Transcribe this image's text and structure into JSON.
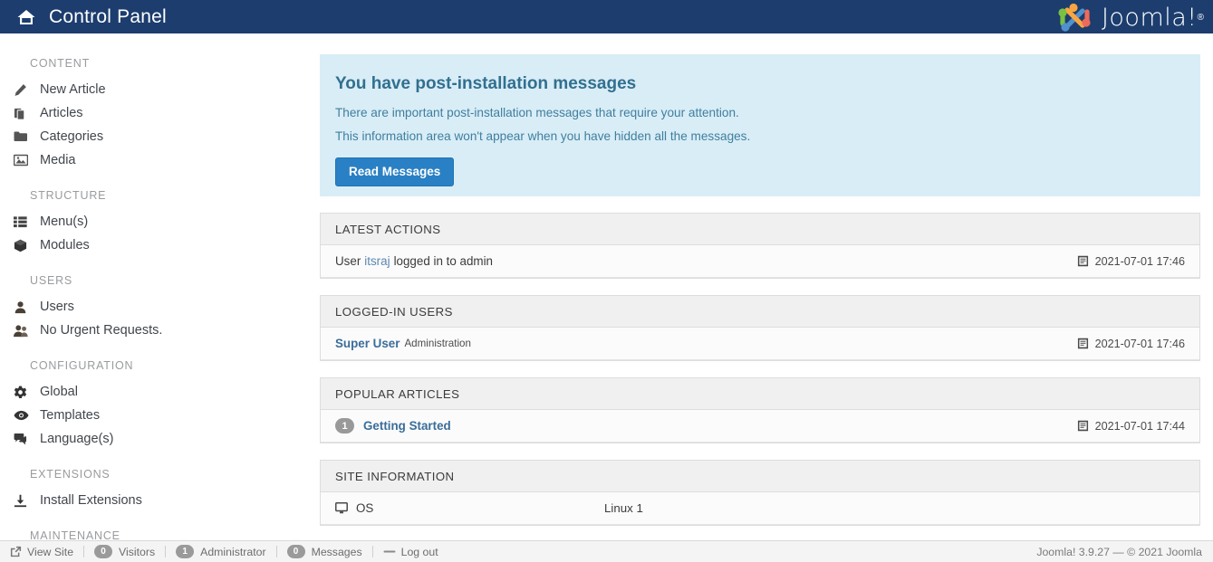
{
  "header": {
    "title": "Control Panel",
    "home_icon": "home-icon",
    "logo_text": "Joomla!",
    "logo_registered": "®",
    "background": "#1c3d6e"
  },
  "sidebar": {
    "groups": [
      {
        "title": "CONTENT",
        "items": [
          {
            "label": "New Article",
            "icon": "pencil-icon"
          },
          {
            "label": "Articles",
            "icon": "copy-icon"
          },
          {
            "label": "Categories",
            "icon": "folder-icon"
          },
          {
            "label": "Media",
            "icon": "image-icon"
          }
        ]
      },
      {
        "title": "STRUCTURE",
        "items": [
          {
            "label": "Menu(s)",
            "icon": "list-icon"
          },
          {
            "label": "Modules",
            "icon": "cube-icon"
          }
        ]
      },
      {
        "title": "USERS",
        "items": [
          {
            "label": "Users",
            "icon": "user-icon"
          },
          {
            "label": "No Urgent Requests.",
            "icon": "users-icon"
          }
        ]
      },
      {
        "title": "CONFIGURATION",
        "items": [
          {
            "label": "Global",
            "icon": "gear-icon"
          },
          {
            "label": "Templates",
            "icon": "eye-icon"
          },
          {
            "label": "Language(s)",
            "icon": "comments-icon"
          }
        ]
      },
      {
        "title": "EXTENSIONS",
        "items": [
          {
            "label": "Install Extensions",
            "icon": "download-icon"
          }
        ]
      },
      {
        "title": "MAINTENANCE",
        "items": []
      }
    ]
  },
  "main": {
    "alert": {
      "title": "You have post-installation messages",
      "line1": "There are important post-installation messages that require your attention.",
      "line2": "This information area won't appear when you have hidden all the messages.",
      "button_label": "Read Messages",
      "background": "#d9edf7",
      "title_color": "#31708f",
      "button_color": "#2a80c4"
    },
    "panels": [
      {
        "heading": "LATEST ACTIONS",
        "type": "actions",
        "rows": [
          {
            "text_before": "User",
            "link": "itsraj",
            "text_after": "logged in to admin",
            "date": "2021-07-01 17:46",
            "date_icon": "calendar-icon"
          }
        ]
      },
      {
        "heading": "LOGGED-IN USERS",
        "type": "users",
        "rows": [
          {
            "name": "Super User",
            "role": "Administration",
            "date": "2021-07-01 17:46",
            "date_icon": "calendar-icon"
          }
        ]
      },
      {
        "heading": "POPULAR ARTICLES",
        "type": "articles",
        "rows": [
          {
            "count": "1",
            "title": "Getting Started",
            "date": "2021-07-01 17:44",
            "date_icon": "calendar-icon"
          }
        ]
      },
      {
        "heading": "SITE INFORMATION",
        "type": "info",
        "rows": [
          {
            "label": "OS",
            "icon": "monitor-icon",
            "value": "Linux 1"
          }
        ]
      }
    ]
  },
  "footer": {
    "items": [
      {
        "label": "View Site",
        "icon": "external-link-icon",
        "badge": null
      },
      {
        "label": "Visitors",
        "icon": null,
        "badge": "0"
      },
      {
        "label": "Administrator",
        "icon": null,
        "badge": "1"
      },
      {
        "label": "Messages",
        "icon": null,
        "badge": "0"
      },
      {
        "label": "Log out",
        "icon": "logout-icon",
        "badge": null
      }
    ],
    "right_text": "Joomla! 3.9.27  —  © 2021 Joomla"
  }
}
